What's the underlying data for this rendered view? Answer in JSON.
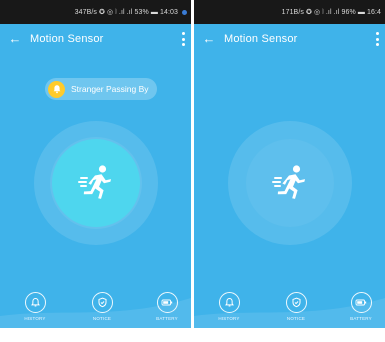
{
  "left_screen": {
    "status_bar": {
      "text": "347B/s ✪ ◎ ⦚ .ıl .ıl 53% ▬ 14:03"
    },
    "app_bar": {
      "title": "Motion Sensor"
    },
    "notification_chip": {
      "label": "Stranger Passing By",
      "icon": "bell-icon"
    },
    "sensor": {
      "state": "active",
      "icon": "running-person-icon"
    },
    "bottom_nav": [
      {
        "label": "HISTORY",
        "icon": "bell-outline-icon"
      },
      {
        "label": "NOTICE",
        "icon": "shield-check-icon"
      },
      {
        "label": "BATTERY",
        "icon": "battery-icon"
      }
    ]
  },
  "right_screen": {
    "status_bar": {
      "text": "171B/s ✪ ◎ ⦚ .ıl .ıl 96% ▬ 16:4"
    },
    "app_bar": {
      "title": "Motion Sensor"
    },
    "sensor": {
      "state": "idle",
      "icon": "running-person-icon"
    },
    "bottom_nav": [
      {
        "label": "HISTORY",
        "icon": "bell-outline-icon"
      },
      {
        "label": "NOTICE",
        "icon": "shield-check-icon"
      },
      {
        "label": "BATTERY",
        "icon": "battery-icon"
      }
    ]
  },
  "colors": {
    "background": "#3fb3ea",
    "active_circle": "#4ed6ee",
    "bell_badge": "#ffcb2b",
    "status_bar": "#181818"
  }
}
